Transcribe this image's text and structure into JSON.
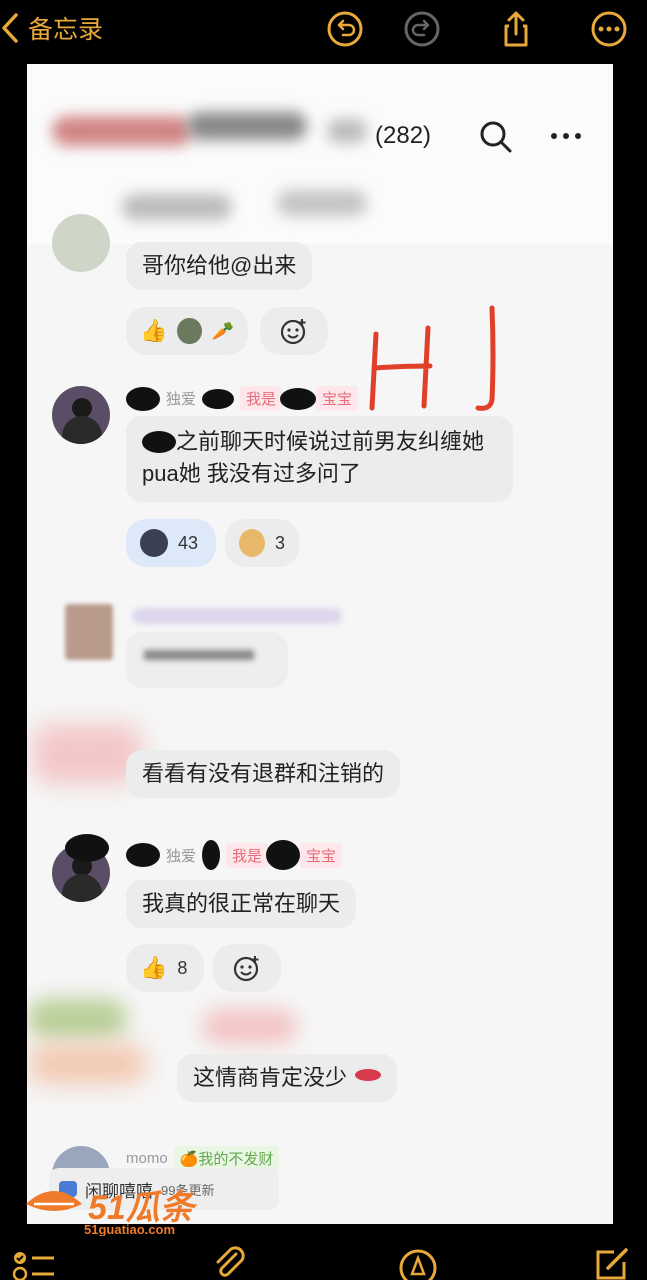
{
  "nav": {
    "back_label": "备忘录"
  },
  "toolbar_icons": [
    "undo-icon",
    "redo-icon",
    "share-icon",
    "more-icon"
  ],
  "bottom_icons": [
    "checklist-icon",
    "attachment-icon",
    "markup-icon",
    "compose-icon"
  ],
  "chat": {
    "member_count": "(282)",
    "annotation": "HJ",
    "messages": [
      {
        "text": "哥你给他@出来"
      },
      {
        "sender_fragment": "独爱",
        "tag": "我是",
        "tag2": "宝宝",
        "text": "之前聊天时候说过前男友纠缠她 pua她 我没有过多问了"
      },
      {
        "text": "看看有没有退群和注销的"
      },
      {
        "sender_fragment": "独爱",
        "tag": "我是",
        "tag2": "宝宝",
        "text": "我真的很正常在聊天"
      },
      {
        "text": "这情商肯定没少"
      },
      {
        "sender": "momo",
        "tag": "🍊我的不发财"
      }
    ],
    "reactions": {
      "r1_count": "43",
      "r2_count": "3",
      "r3_count": "8"
    },
    "footer_preview": {
      "title": "闲聊嘻嘻",
      "sub": "99条更新"
    }
  },
  "watermark": {
    "brand": "51瓜条",
    "url": "51guatiao.com"
  },
  "colors": {
    "accent": "#e8a93a",
    "handwriting": "#e0402a"
  }
}
